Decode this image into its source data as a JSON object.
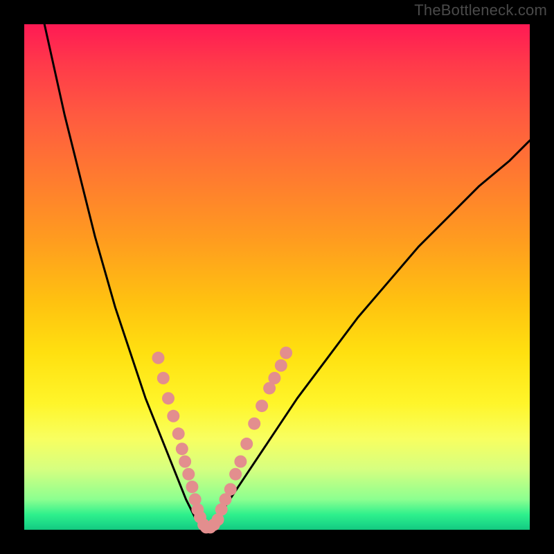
{
  "watermark": "TheBottleneck.com",
  "chart_data": {
    "type": "line",
    "title": "",
    "xlabel": "",
    "ylabel": "",
    "xlim": [
      0,
      100
    ],
    "ylim": [
      0,
      100
    ],
    "grid": false,
    "legend": false,
    "series": [
      {
        "name": "bottleneck-curve",
        "x": [
          4,
          6,
          8,
          10,
          12,
          14,
          16,
          18,
          20,
          22,
          24,
          26,
          28,
          30,
          32,
          34,
          36,
          38,
          40,
          44,
          48,
          54,
          60,
          66,
          72,
          78,
          84,
          90,
          96,
          100
        ],
        "y": [
          100,
          91,
          82,
          74,
          66,
          58,
          51,
          44,
          38,
          32,
          26,
          21,
          16,
          11,
          6,
          2,
          0,
          2,
          5,
          11,
          17,
          26,
          34,
          42,
          49,
          56,
          62,
          68,
          73,
          77
        ]
      }
    ],
    "scatter_points": {
      "name": "highlight-dots",
      "color": "#e38e8e",
      "points": [
        {
          "x": 26.5,
          "y": 34
        },
        {
          "x": 27.5,
          "y": 30
        },
        {
          "x": 28.5,
          "y": 26
        },
        {
          "x": 29.5,
          "y": 22.5
        },
        {
          "x": 30.5,
          "y": 19
        },
        {
          "x": 31.2,
          "y": 16
        },
        {
          "x": 31.8,
          "y": 13.5
        },
        {
          "x": 32.5,
          "y": 11
        },
        {
          "x": 33.2,
          "y": 8.5
        },
        {
          "x": 33.8,
          "y": 6
        },
        {
          "x": 34.3,
          "y": 4
        },
        {
          "x": 34.8,
          "y": 2.5
        },
        {
          "x": 35.5,
          "y": 1
        },
        {
          "x": 36.0,
          "y": 0.5
        },
        {
          "x": 36.8,
          "y": 0.5
        },
        {
          "x": 37.5,
          "y": 1
        },
        {
          "x": 38.3,
          "y": 2
        },
        {
          "x": 39.0,
          "y": 4
        },
        {
          "x": 39.8,
          "y": 6
        },
        {
          "x": 40.8,
          "y": 8
        },
        {
          "x": 41.8,
          "y": 11
        },
        {
          "x": 42.8,
          "y": 13.5
        },
        {
          "x": 44.0,
          "y": 17
        },
        {
          "x": 45.5,
          "y": 21
        },
        {
          "x": 47.0,
          "y": 24.5
        },
        {
          "x": 48.5,
          "y": 28
        },
        {
          "x": 49.5,
          "y": 30
        },
        {
          "x": 50.8,
          "y": 32.5
        },
        {
          "x": 51.8,
          "y": 35
        }
      ]
    },
    "note": "V-shaped bottleneck curve over rainbow 0–100% gradient; minimum near x≈36; pink markers cluster around the dip region (roughly 26–52 on x, 0–35 on y)."
  }
}
